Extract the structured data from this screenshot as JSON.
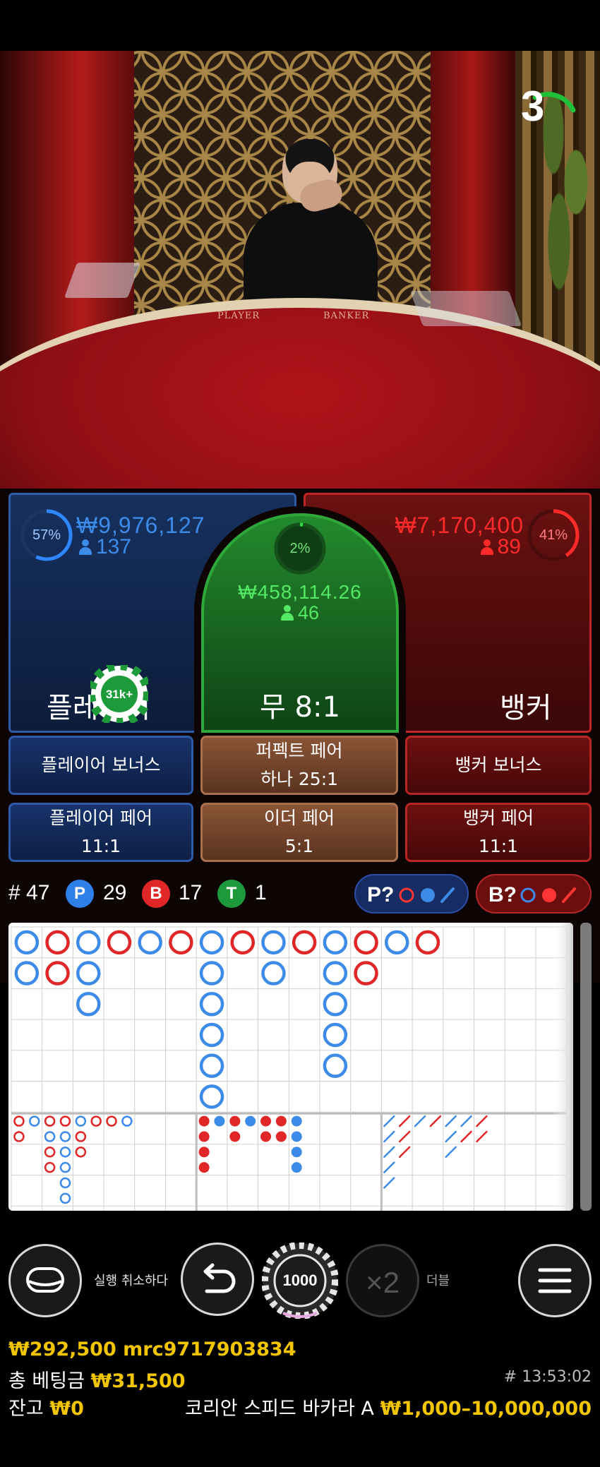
{
  "video": {
    "countdown": "3",
    "felt_player": "PLAYER",
    "felt_banker": "BANKER"
  },
  "player": {
    "percent": "57%",
    "percent_value": 57,
    "amount": "₩9,976,127",
    "players": "137",
    "label": "플레이어",
    "chip": "31k+"
  },
  "tie": {
    "percent": "2%",
    "percent_value": 2,
    "amount": "₩458,114.26",
    "players": "46",
    "label": "무 8:1"
  },
  "banker": {
    "percent": "41%",
    "percent_value": 41,
    "amount": "₩7,170,400",
    "players": "89",
    "label": "뱅커"
  },
  "side_bets": {
    "player_bonus": "플레이어 보너스",
    "perfect_pair": "퍼펙트 페어",
    "perfect_pair_odds": "하나 25:1",
    "banker_bonus": "뱅커 보너스",
    "player_pair": "플레이어 페어",
    "player_pair_odds": "11:1",
    "either_pair": "이더 페어",
    "either_pair_odds": "5:1",
    "banker_pair": "뱅커 페어",
    "banker_pair_odds": "11:1"
  },
  "stats": {
    "round_label": "# 47",
    "p_letter": "P",
    "p_count": "29",
    "b_letter": "B",
    "b_count": "17",
    "t_letter": "T",
    "t_count": "1",
    "player_predict": "P?",
    "banker_predict": "B?"
  },
  "colors": {
    "player_blue": "#3d8be8",
    "banker_red": "#e02626",
    "tie_green": "#2fa83a",
    "gold": "#f2c500"
  },
  "roadmap": {
    "big_road": [
      [
        "P",
        "P"
      ],
      [
        "B",
        "B"
      ],
      [
        "P",
        "P",
        "P"
      ],
      [
        "B"
      ],
      [
        "P"
      ],
      [
        "B"
      ],
      [
        "P",
        "P",
        "P",
        "P",
        "P",
        "P"
      ],
      [
        "B"
      ],
      [
        "P",
        "P"
      ],
      [
        "B"
      ],
      [
        "P",
        "P",
        "P",
        "P",
        "P"
      ],
      [
        "B",
        "B"
      ],
      [
        "P"
      ],
      [
        "B"
      ]
    ]
  },
  "controls": {
    "undo_label": "실행 취소하다",
    "chip_value": "1000",
    "double_symbol": "×2",
    "double_label": "더블"
  },
  "info": {
    "balance_user": "₩292,500 mrc9717903834",
    "total_bet_label": "총 베팅금",
    "total_bet_value": "₩31,500",
    "time": "# 13:53:02",
    "balance_label": "잔고",
    "balance_value": "₩0",
    "table_name": "코리안 스피드 바카라 A",
    "limits": "₩1,000–10,000,000"
  }
}
